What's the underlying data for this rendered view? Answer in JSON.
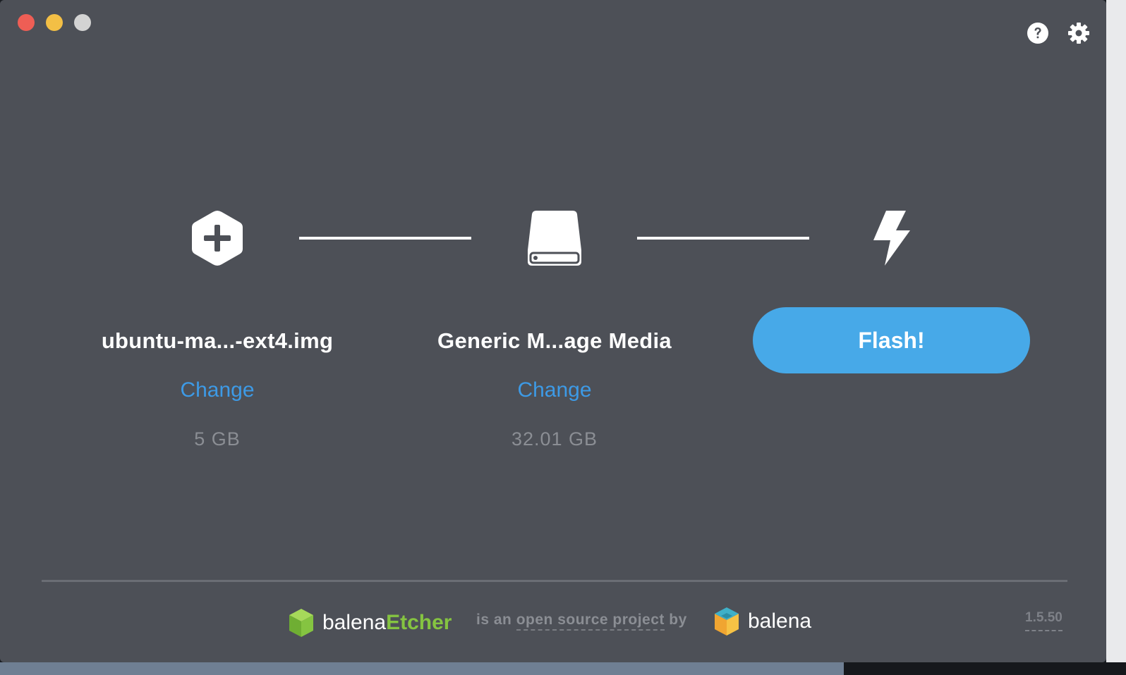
{
  "window": {
    "controls": [
      "close",
      "minimize",
      "zoom"
    ]
  },
  "toolbar": {
    "help_icon": "question-circle-icon",
    "settings_icon": "gear-icon"
  },
  "steps": {
    "image": {
      "icon": "hexagon-plus-icon",
      "title": "ubuntu-ma...-ext4.img",
      "change_label": "Change",
      "size": "5 GB"
    },
    "drive": {
      "icon": "drive-icon",
      "title": "Generic M...age Media",
      "change_label": "Change",
      "size": "32.01 GB"
    },
    "flash": {
      "icon": "lightning-bolt-icon",
      "button_label": "Flash!"
    }
  },
  "footer": {
    "etcher_word1": "balena",
    "etcher_word2": "Etcher",
    "tagline_prefix": "is an ",
    "tagline_link": "open source project",
    "tagline_suffix": " by",
    "balena_word": "balena",
    "version": "1.5.50"
  },
  "colors": {
    "background": "#4d5057",
    "accent": "#47a9e8",
    "link": "#3d9ae6",
    "etcher_green": "#85c441",
    "muted": "#8b8e94"
  }
}
